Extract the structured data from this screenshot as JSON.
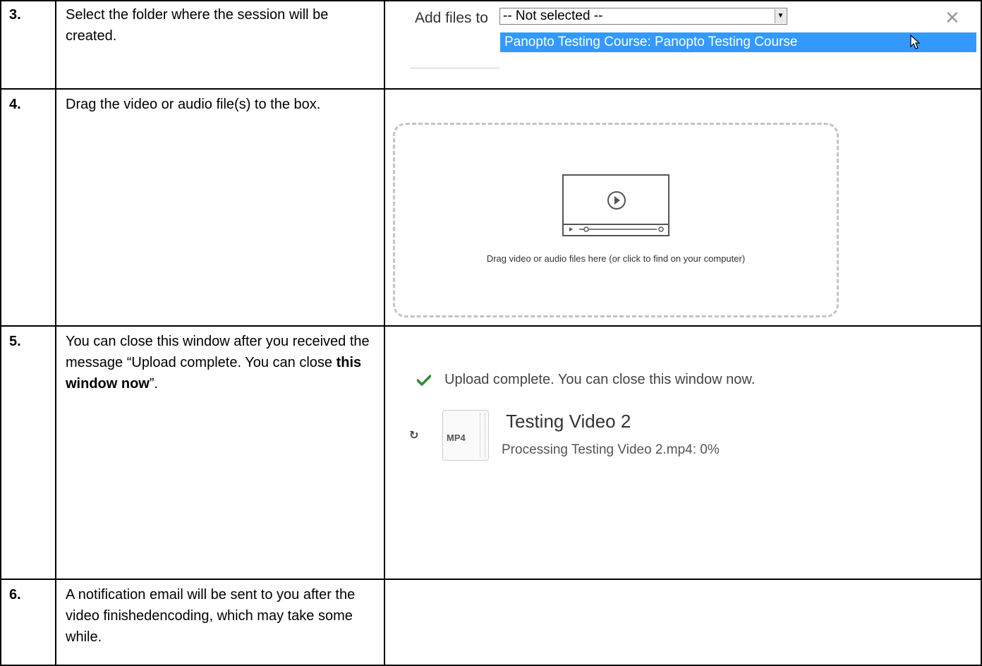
{
  "rows": [
    {
      "number": "3.",
      "instruction": "Select the folder where the session will be created."
    },
    {
      "number": "4.",
      "instruction": "Drag the video or audio file(s) to the box."
    },
    {
      "number": "5.",
      "instruction_before": "You can close this window after you received the message “Upload complete. You can close ",
      "instruction_bold": "this window now",
      "instruction_after": "”."
    },
    {
      "number": "6.",
      "instruction": "A notification email will be sent to you after the video finishedencoding, which may take some while."
    }
  ],
  "folder_select": {
    "label": "Add files to",
    "selected_value": "-- Not selected --",
    "highlighted_option": "Panopto Testing Course: Panopto Testing Course",
    "highlight_color": "#3399ff"
  },
  "dropzone": {
    "text": "Drag video or audio files here (or click to find on your computer)"
  },
  "upload_status": {
    "message": "Upload complete. You can close this window now.",
    "check_color": "#2e8b2e",
    "file_type": "MP4",
    "video_title": "Testing Video 2",
    "processing": "Processing Testing Video 2.mp4: 0%"
  }
}
